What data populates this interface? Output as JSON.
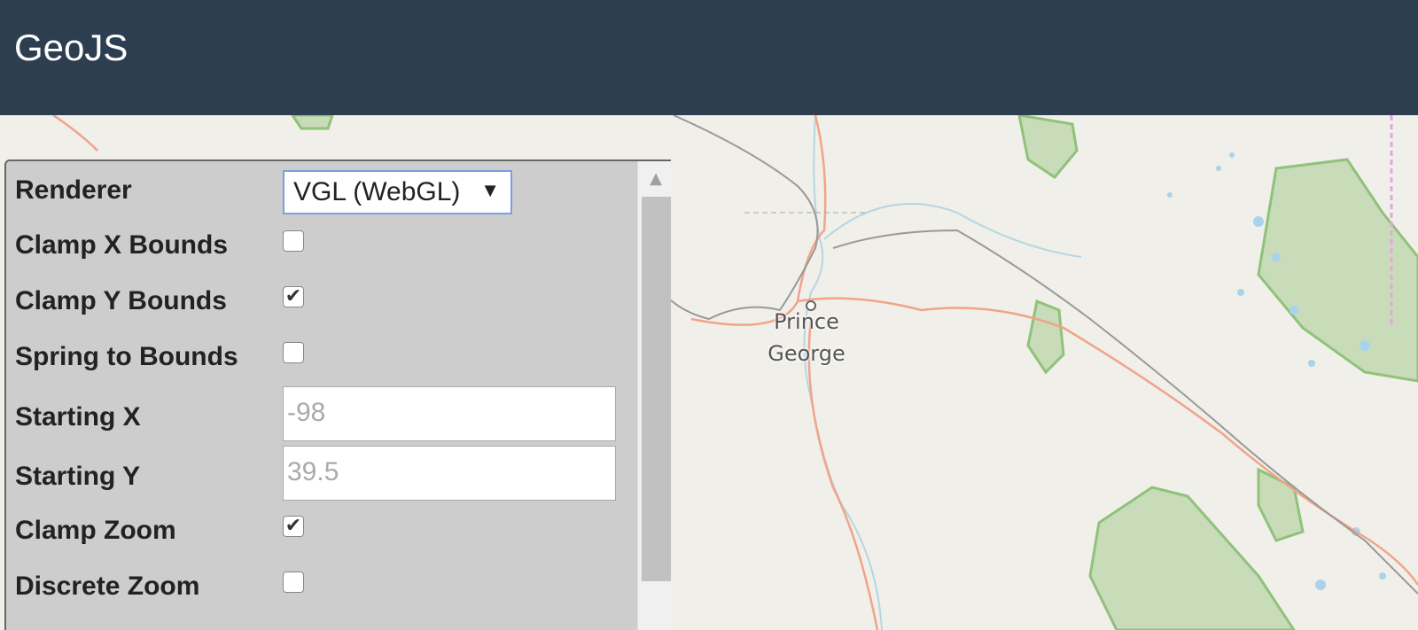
{
  "header": {
    "title": "GeoJS"
  },
  "map": {
    "city_label_line1": "Prince",
    "city_label_line2": "George"
  },
  "panel": {
    "renderer_label": "Renderer",
    "renderer_value": "VGL (WebGL)",
    "clamp_x_label": "Clamp X Bounds",
    "clamp_x_checked": false,
    "clamp_y_label": "Clamp Y Bounds",
    "clamp_y_checked": true,
    "spring_label": "Spring to Bounds",
    "spring_checked": false,
    "start_x_label": "Starting X",
    "start_x_placeholder": "-98",
    "start_y_label": "Starting Y",
    "start_y_placeholder": "39.5",
    "clamp_zoom_label": "Clamp Zoom",
    "clamp_zoom_checked": true,
    "discrete_zoom_label": "Discrete Zoom",
    "discrete_zoom_checked": false
  }
}
